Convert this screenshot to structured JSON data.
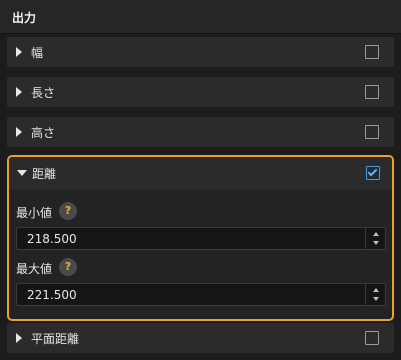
{
  "panel": {
    "title": "出力",
    "items": [
      {
        "label": "幅",
        "checked": false
      },
      {
        "label": "長さ",
        "checked": false
      },
      {
        "label": "高さ",
        "checked": false
      }
    ],
    "expanded": {
      "label": "距離",
      "checked": true,
      "fields": [
        {
          "label": "最小値",
          "help": "?",
          "value": "218.500"
        },
        {
          "label": "最大値",
          "help": "?",
          "value": "221.500"
        }
      ]
    },
    "after": {
      "label": "平面距離",
      "checked": false
    }
  },
  "colors": {
    "accent_border": "#e8a033",
    "checkbox_checked": "#5fb0f0",
    "help_icon": "#e8b23a"
  },
  "icons": {
    "collapsed": "caret-right-icon",
    "expanded": "caret-down-icon",
    "help": "help-icon",
    "spin_up": "spin-up-icon",
    "spin_down": "spin-down-icon",
    "check": "checkmark-icon"
  }
}
